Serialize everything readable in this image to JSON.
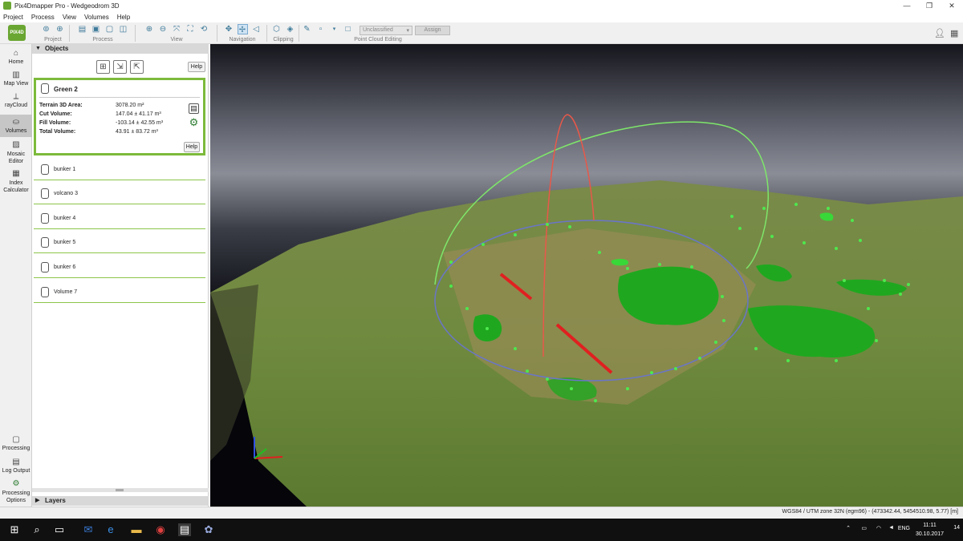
{
  "window": {
    "title": "Pix4Dmapper Pro - Wedgeodrom 3D",
    "controls": [
      "—",
      "❐",
      "✕"
    ]
  },
  "menu": [
    "Project",
    "Process",
    "View",
    "Volumes",
    "Help"
  ],
  "toolbar": {
    "logo_text": "PIX4D",
    "groups": [
      "Project",
      "Process",
      "View",
      "Navigation",
      "Clipping",
      "Point Cloud Editing"
    ],
    "classification_dropdown": "Unclassified",
    "assign_label": "Assign"
  },
  "leftnav": {
    "items": [
      {
        "label": "Home",
        "icon": "home-icon"
      },
      {
        "label": "Map View",
        "icon": "map-icon"
      },
      {
        "label": "rayCloud",
        "icon": "axes-icon"
      },
      {
        "label": "Volumes",
        "icon": "cylinder-icon",
        "active": true
      },
      {
        "label": "Mosaic Editor",
        "icon": "image-icon"
      },
      {
        "label": "Index Calculator",
        "icon": "grid-icon"
      }
    ],
    "bottom": [
      {
        "label": "Processing",
        "icon": "processing-icon"
      },
      {
        "label": "Log Output",
        "icon": "log-icon"
      },
      {
        "label": "Processing Options",
        "icon": "gear-icon"
      }
    ]
  },
  "objects": {
    "header": "Objects",
    "help": "Help",
    "selected": {
      "name": "Green 2",
      "rows": [
        {
          "label": "Terrain 3D Area:",
          "value": "3078.20 m²"
        },
        {
          "label": "Cut Volume:",
          "value": "147.04 ± 41.17 m³"
        },
        {
          "label": "Fill Volume:",
          "value": "-103.14 ± 42.55 m³"
        },
        {
          "label": "Total Volume:",
          "value": "43.91 ± 83.72 m³"
        }
      ],
      "help": "Help"
    },
    "items": [
      "bunker 1",
      "volcano 3",
      "bunker 4",
      "bunker 5",
      "bunker 6",
      "Volume 7"
    ]
  },
  "layers": {
    "header": "Layers"
  },
  "statusbar": {
    "coords": "WGS84 / UTM zone 32N (egm96) - (473342.44, 5454510.98, 5.77) [m]"
  },
  "taskbar": {
    "language": "ENG",
    "time": "11:11",
    "date": "30.10.2017",
    "notification_count": "14"
  },
  "colors": {
    "accent_green": "#7dba3c",
    "toolbar_bg": "#f0f0f0",
    "sphere_green": "#7ee66a",
    "axis_red": "#e8584a",
    "circle_blue": "#6a75c8"
  }
}
